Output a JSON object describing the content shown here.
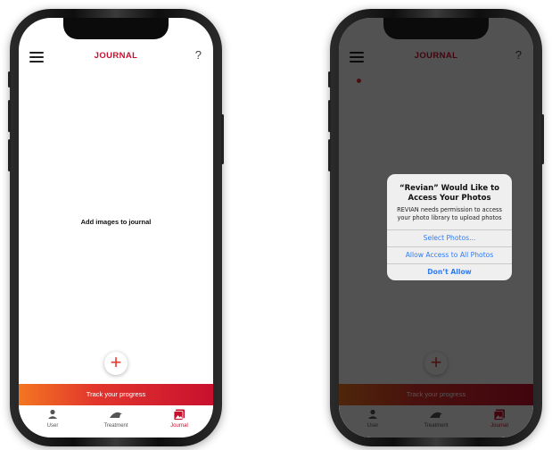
{
  "header": {
    "title": "JOURNAL",
    "help": "?"
  },
  "journal": {
    "empty_text": "Add images to journal",
    "add_button": "+"
  },
  "track_bar": {
    "label": "Track your progress"
  },
  "tabs": [
    {
      "label": "User",
      "icon": "user-icon"
    },
    {
      "label": "Treatment",
      "icon": "treatment-device-icon"
    },
    {
      "label": "Journal",
      "icon": "journal-photos-icon",
      "active": true
    }
  ],
  "permission_alert": {
    "title": "“Revian” Would Like to Access Your Photos",
    "message": "REVIAN needs permission to access your photo library to upload photos",
    "buttons": [
      "Select Photos...",
      "Allow Access to All Photos",
      "Don’t Allow"
    ]
  },
  "colors": {
    "brand_red": "#c8102e",
    "gradient_orange": "#f37621",
    "ios_blue": "#2f7cf6"
  }
}
